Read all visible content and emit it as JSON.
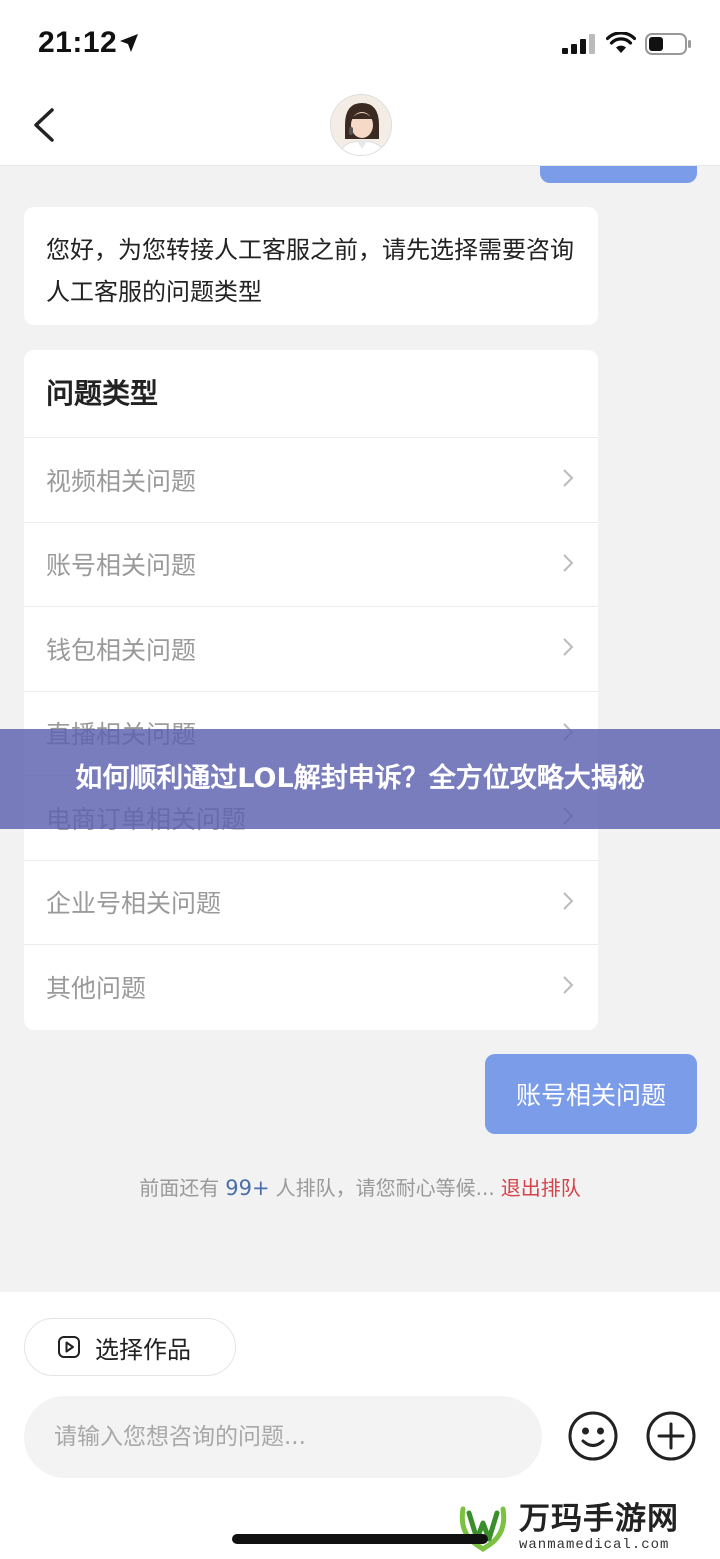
{
  "status_bar": {
    "time": "21:12",
    "icons": [
      "location-arrow-icon",
      "signal-icon",
      "wifi-icon",
      "battery-icon"
    ]
  },
  "nav": {
    "back_icon": "chevron-left-icon",
    "avatar": "agent-avatar"
  },
  "messages": {
    "greeting": "您好，为您转接人工客服之前，请先选择需要咨询人工客服的问题类型"
  },
  "question_types": {
    "title": "问题类型",
    "items": [
      "视频相关问题",
      "账号相关问题",
      "钱包相关问题",
      "直播相关问题",
      "电商订单相关问题",
      "企业号相关问题",
      "其他问题"
    ]
  },
  "overlay_banner": {
    "text": "如何顺利通过LOL解封申诉？全方位攻略大揭秘"
  },
  "sent": {
    "text": "账号相关问题"
  },
  "queue": {
    "prefix": "前面还有",
    "count": "99+",
    "suffix": "人排队，请您耐心等候...",
    "exit_label": "退出排队"
  },
  "bottom": {
    "select_work_label": "选择作品",
    "input_placeholder": "请输入您想咨询的问题...",
    "emoji_icon": "smiley-icon",
    "plus_icon": "plus-circle-icon"
  },
  "watermark": {
    "brand": "万玛手游网",
    "url": "wanmamedical.com"
  },
  "colors": {
    "bubble_blue": "#7b9ce8",
    "exit_red": "#d6434a",
    "banner_purple": "#5c60b0"
  }
}
